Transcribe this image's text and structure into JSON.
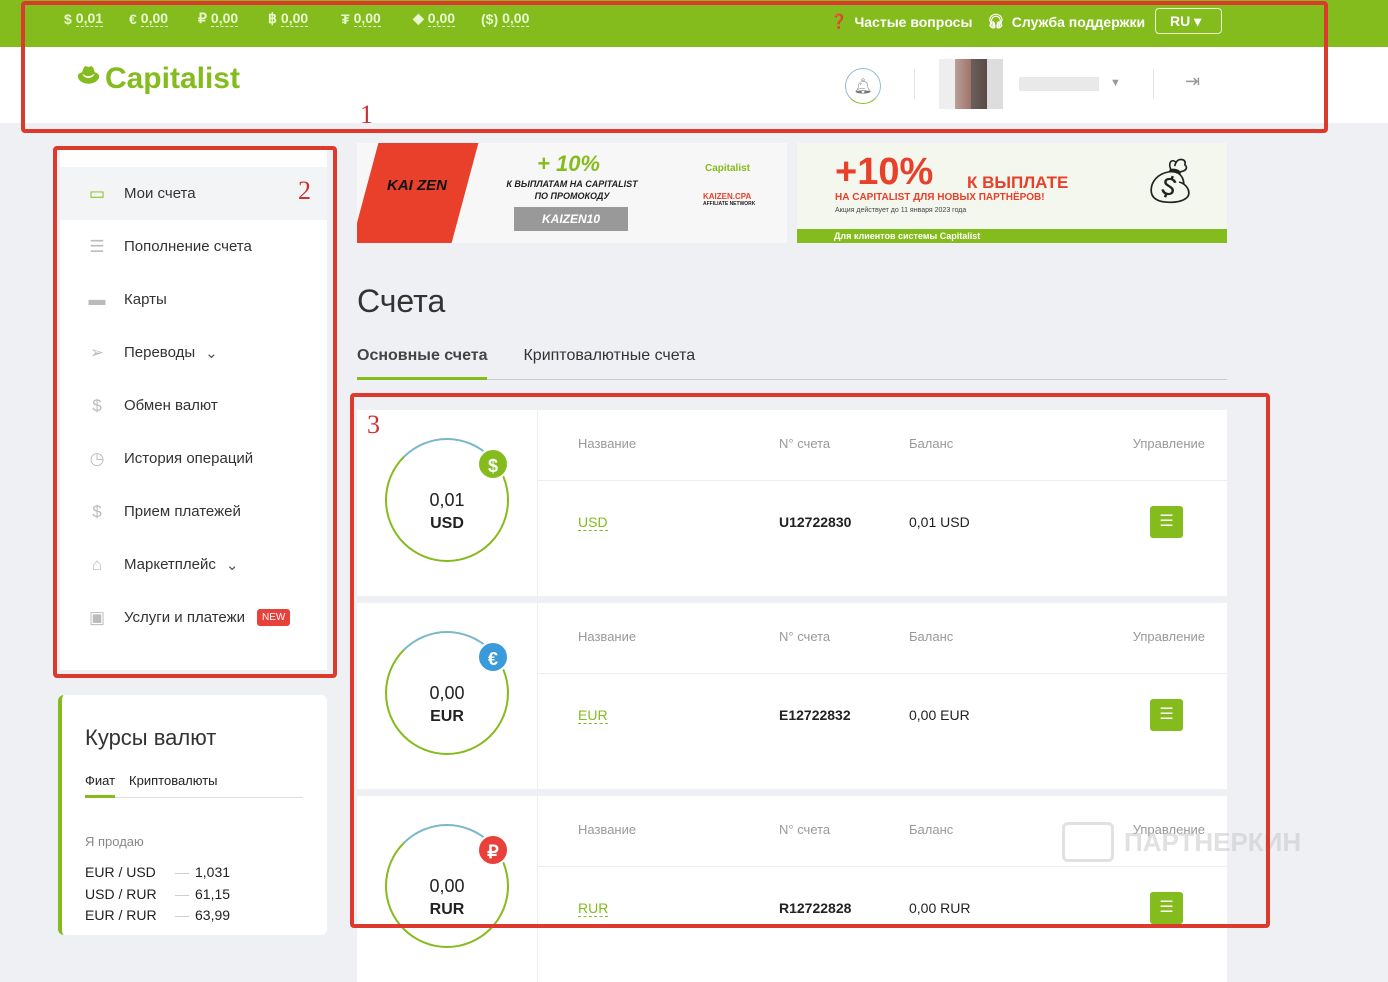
{
  "topbar": {
    "balances": [
      {
        "icon": "$",
        "value": "0,01"
      },
      {
        "icon": "€",
        "value": "0,00"
      },
      {
        "icon": "₽",
        "value": "0,00"
      },
      {
        "icon": "฿",
        "value": "0,00"
      },
      {
        "icon": "₮",
        "value": "0,00"
      },
      {
        "icon": "◆",
        "value": "0,00"
      },
      {
        "icon": "($)",
        "value": "0,00"
      }
    ],
    "faq": "Частые вопросы",
    "support": "Служба поддержки",
    "lang": "RU"
  },
  "header": {
    "logo": "Capitalist"
  },
  "annotations": [
    "1",
    "2",
    "3"
  ],
  "sidebar": {
    "items": [
      {
        "label": "Мои счета"
      },
      {
        "label": "Пополнение счета"
      },
      {
        "label": "Карты"
      },
      {
        "label": "Переводы"
      },
      {
        "label": "Обмен валют"
      },
      {
        "label": "История операций"
      },
      {
        "label": "Прием платежей"
      },
      {
        "label": "Маркетплейс"
      },
      {
        "label": "Услуги и платежи",
        "badge": "NEW"
      }
    ]
  },
  "rates": {
    "title": "Курсы валют",
    "tabs": [
      "Фиат",
      "Криптовалюты"
    ],
    "subtitle": "Я продаю",
    "rows": [
      {
        "pair": "EUR / USD",
        "value": "1,031"
      },
      {
        "pair": "USD / RUR",
        "value": "61,15"
      },
      {
        "pair": "EUR / RUR",
        "value": "63,99"
      }
    ]
  },
  "banners": {
    "kaizen": {
      "logo": "KAI ZEN",
      "headline": "+ 10%",
      "line1": "К ВЫПЛАТАМ НА CAPITALIST",
      "line2": "ПО ПРОМОКОДУ",
      "code": "KAIZEN10",
      "partner": "KAIZEN.CPA",
      "partner_sub": "AFFILIATE NETWORK"
    },
    "mp": {
      "headline": "+10%",
      "headline2": "К ВЫПЛАТЕ",
      "line1": "НА CAPITALIST ДЛЯ НОВЫХ ПАРТНЁРОВ!",
      "line2": "Акция действует до 11 января 2023 года",
      "footer": "Для клиентов системы Capitalist"
    }
  },
  "page": {
    "title": "Счета",
    "tabs": [
      "Основные счета",
      "Криптовалютные счета"
    ]
  },
  "table_headers": {
    "name": "Название",
    "number": "N° счета",
    "balance": "Баланс",
    "manage": "Управление"
  },
  "accounts": [
    {
      "amount": "0,01",
      "currency": "USD",
      "symbol": "$",
      "color": "#84bc1e",
      "name": "USD",
      "number": "U12722830",
      "balance": "0,01 USD"
    },
    {
      "amount": "0,00",
      "currency": "EUR",
      "symbol": "€",
      "color": "#3b9ad9",
      "name": "EUR",
      "number": "E12722832",
      "balance": "0,00 EUR"
    },
    {
      "amount": "0,00",
      "currency": "RUR",
      "symbol": "₽",
      "color": "#e8403a",
      "name": "RUR",
      "number": "R12722828",
      "balance": "0,00 RUR"
    }
  ],
  "watermark": "ПАРТНЕРКИН"
}
